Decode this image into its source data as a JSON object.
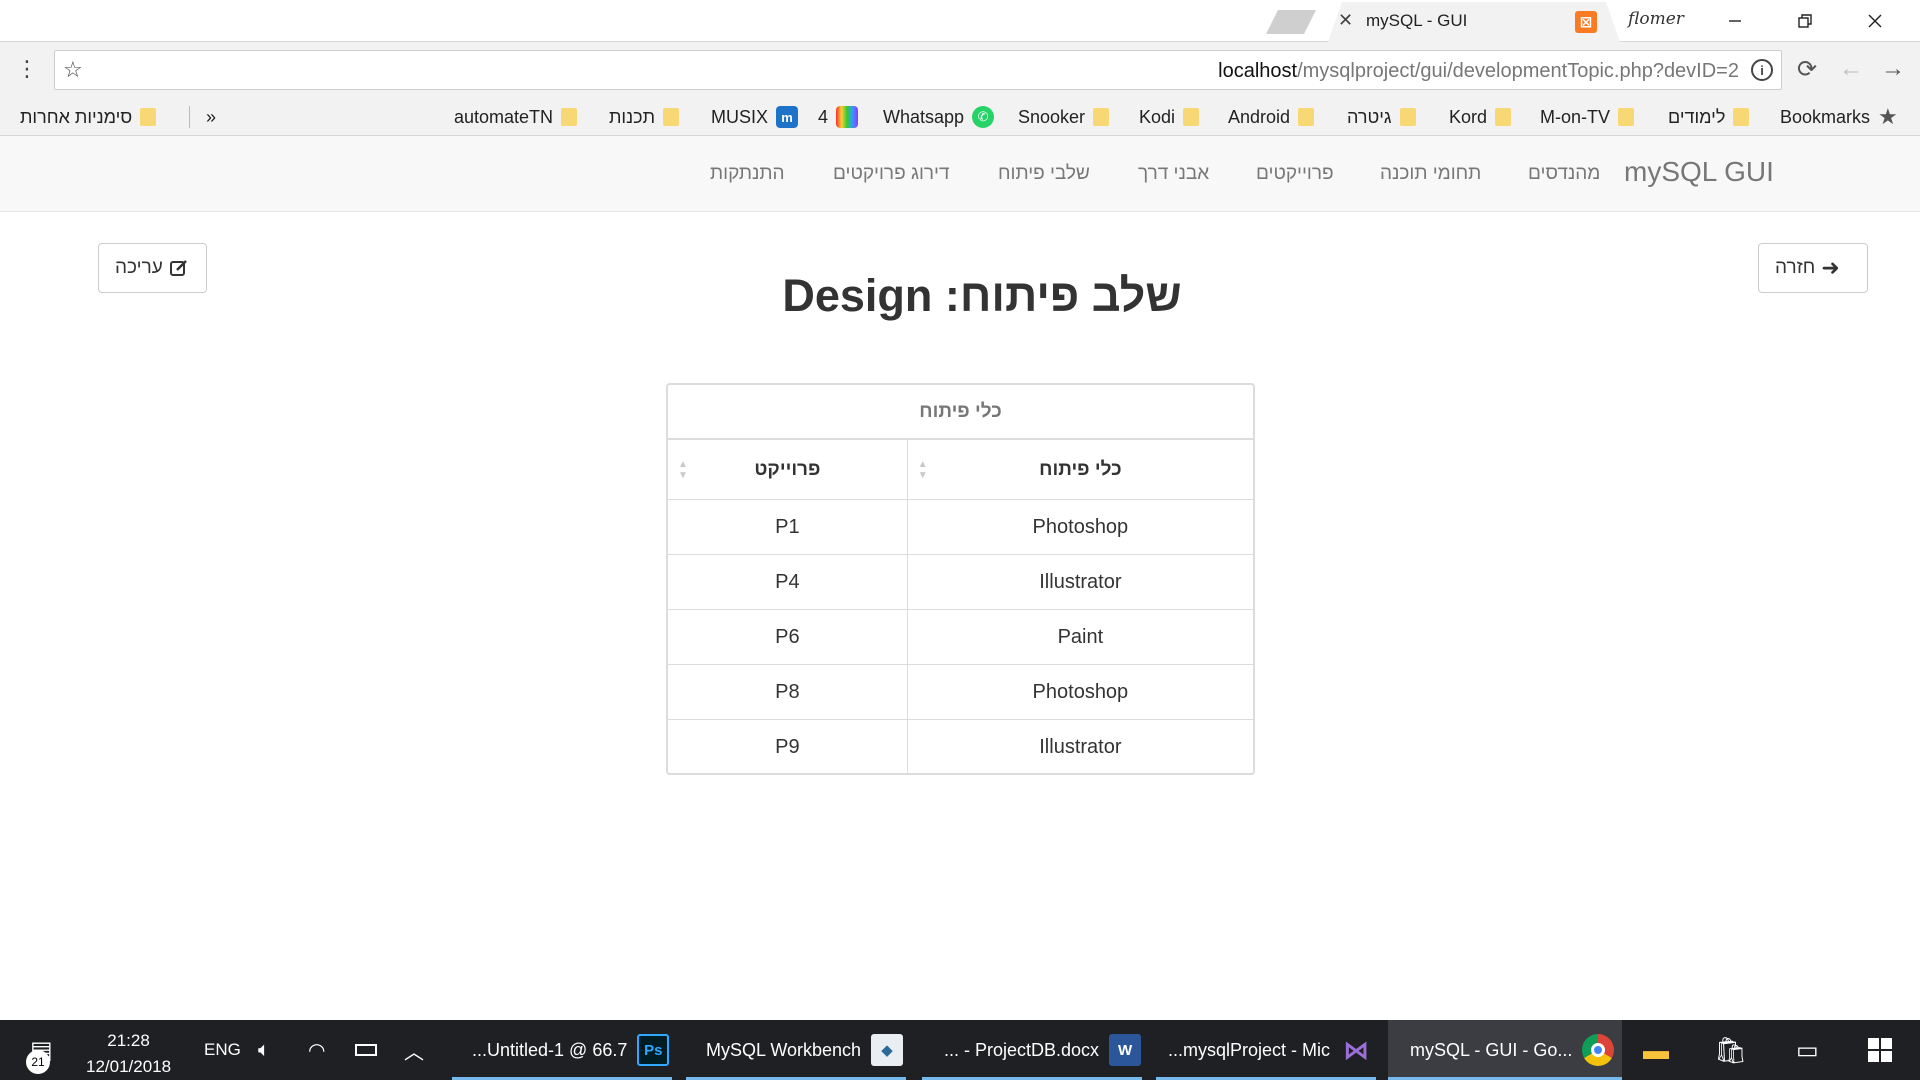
{
  "browser": {
    "tab_title": "mySQL - GUI",
    "profile_name": "flomer",
    "url_host": "localhost",
    "url_path": "/mysqlproject/gui/developmentTopic.php?devID=2"
  },
  "bookmarks": {
    "items": [
      {
        "label": "Bookmarks",
        "icon": "star-icon"
      },
      {
        "label": "לימודים",
        "icon": "folder-icon"
      },
      {
        "label": "M-on-TV",
        "icon": "folder-icon"
      },
      {
        "label": "Kord",
        "icon": "folder-icon"
      },
      {
        "label": "גיטרה",
        "icon": "folder-icon"
      },
      {
        "label": "Android",
        "icon": "folder-icon"
      },
      {
        "label": "Kodi",
        "icon": "folder-icon"
      },
      {
        "label": "Snooker",
        "icon": "folder-icon"
      },
      {
        "label": "Whatsapp",
        "icon": "whatsapp-icon"
      },
      {
        "label": "4",
        "icon": "tv-icon"
      },
      {
        "label": "MUSIX",
        "icon": "musix-icon"
      },
      {
        "label": "תכנות",
        "icon": "folder-icon"
      },
      {
        "label": "automateTN",
        "icon": "folder-icon"
      }
    ],
    "overflow": "»",
    "other_bookmarks": "סימניות אחרות"
  },
  "navbar": {
    "brand": "mySQL GUI",
    "links": [
      "מהנדסים",
      "תחומי תוכנה",
      "פרוייקטים",
      "אבני דרך",
      "שלבי פיתוח",
      "דירוג פרויקטים",
      "התנתקות"
    ]
  },
  "page": {
    "back_label": "חזרה",
    "edit_label": "עריכה",
    "title": "שלב פיתוח: Design"
  },
  "table": {
    "caption": "כלי פיתוח",
    "headers": [
      "כלי פיתוח",
      "פרוייקט"
    ],
    "rows": [
      [
        "Photoshop",
        "P1"
      ],
      [
        "Illustrator",
        "P4"
      ],
      [
        "Paint",
        "P6"
      ],
      [
        "Photoshop",
        "P8"
      ],
      [
        "Illustrator",
        "P9"
      ]
    ]
  },
  "taskbar": {
    "apps": [
      {
        "label": "mySQL - GUI - Go...",
        "icon": "chrome-icon"
      },
      {
        "label": "...mysqlProject - Mic",
        "icon": "visual-studio-icon"
      },
      {
        "label": "... - ProjectDB.docx",
        "icon": "word-icon"
      },
      {
        "label": "MySQL Workbench",
        "icon": "mysql-workbench-icon"
      },
      {
        "label": "...Untitled-1 @ 66.7",
        "icon": "photoshop-icon"
      }
    ],
    "language": "ENG",
    "time": "21:28",
    "date": "12/01/2018",
    "notification_count": "21"
  },
  "colors": {
    "navbar_bg": "#f8f8f8",
    "taskbar_bg": "#1f2023",
    "folder": "#f8d775",
    "xampp_orange": "#fb7a24"
  }
}
